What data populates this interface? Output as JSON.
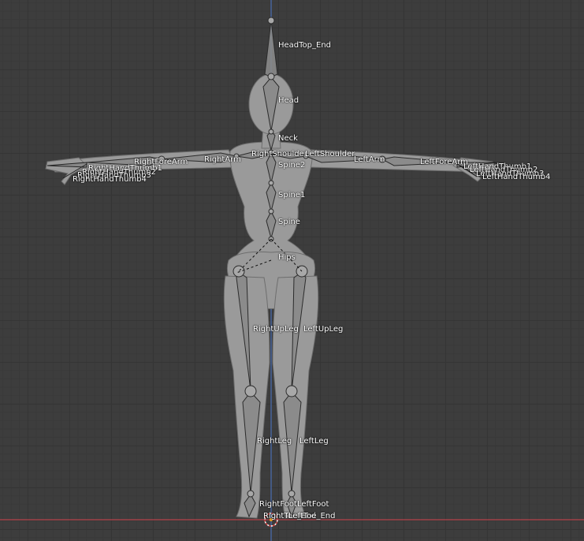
{
  "viewport": {
    "axis_colors": {
      "x_axis": "#b5424a",
      "z_axis": "#4a6fb5"
    },
    "background": "#3d3d3d",
    "mesh_color": "#9a9a9a"
  },
  "bones": {
    "headtop_end": "HeadTop_End",
    "head": "Head",
    "neck": "Neck",
    "right_shoulder": "RightShoulder",
    "left_shoulder": "LeftShoulder",
    "spine2": "Spine2",
    "spine1": "Spine1",
    "spine": "Spine",
    "hips": "Hips",
    "right_arm": "RightArm",
    "left_arm": "LeftArm",
    "right_forearm": "RightForeArm",
    "left_forearm": "LeftForeArm",
    "right_hand_thumb1": "RightHandThumb1",
    "right_hand_thumb2": "RightHandThumb2",
    "right_hand_thumb3": "RightHandThumb3",
    "right_hand_thumb4": "RightHandThumb4",
    "left_hand_thumb1": "LeftHandThumb1",
    "left_hand_thumb2": "LeftHandThumb2",
    "left_hand_thumb3": "LeftHandThumb3",
    "left_hand_thumb4": "LeftHandThumb4",
    "right_up_leg": "RightUpLeg",
    "left_up_leg": "LeftUpLeg",
    "right_leg": "RightLeg",
    "left_leg": "LeftLeg",
    "right_foot": "RightFoot",
    "left_foot": "LeftFoot",
    "right_toe_end": "RightToe_End",
    "left_toe_end": "LeftToe_End"
  }
}
